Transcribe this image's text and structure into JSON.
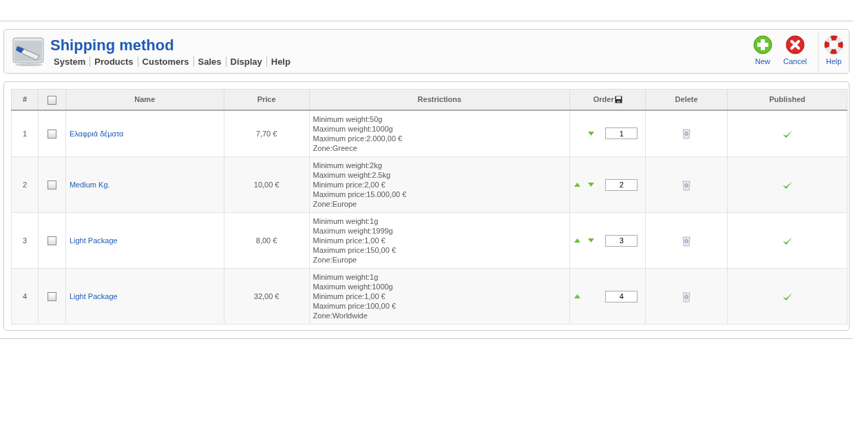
{
  "header": {
    "title": "Shipping method",
    "menu": [
      "System",
      "Products",
      "Customers",
      "Sales",
      "Display",
      "Help"
    ]
  },
  "toolbar": [
    {
      "kind": "new",
      "label": "New"
    },
    {
      "kind": "cancel",
      "label": "Cancel"
    },
    {
      "kind": "help",
      "label": "Help"
    }
  ],
  "table": {
    "columns": [
      "#",
      "Name",
      "Price",
      "Restrictions",
      "Order",
      "Delete",
      "Published"
    ],
    "select_all_checked": false,
    "rows": [
      {
        "number": "1",
        "checked": false,
        "name": "Ελαφριά δέματα",
        "price": "7,70 €",
        "restrictions": [
          "Minimum weight:50g",
          "Maximum weight:1000g",
          "Maximum price:2.000,00 €",
          "Zone:Greece"
        ],
        "move_up": false,
        "move_down": true,
        "order": "1",
        "published": true
      },
      {
        "number": "2",
        "checked": false,
        "name": "Medium Kg.",
        "price": "10,00 €",
        "restrictions": [
          "Minimum weight:2kg",
          "Maximum weight:2.5kg",
          "Minimum price:2,00 €",
          "Maximum price:15.000,00 €",
          "Zone:Europe"
        ],
        "move_up": true,
        "move_down": true,
        "order": "2",
        "published": true
      },
      {
        "number": "3",
        "checked": false,
        "name": "Light Package",
        "price": "8,00 €",
        "restrictions": [
          "Minimum weight:1g",
          "Maximum weight:1999g",
          "Minimum price:1,00 €",
          "Maximum price:150,00 €",
          "Zone:Europe"
        ],
        "move_up": true,
        "move_down": true,
        "order": "3",
        "published": true
      },
      {
        "number": "4",
        "checked": false,
        "name": "Light Package",
        "price": "32,00 €",
        "restrictions": [
          "Minimum weight:1g",
          "Maximum weight:1000g",
          "Minimum price:1,00 €",
          "Maximum price:100,00 €",
          "Zone:Worldwide"
        ],
        "move_up": true,
        "move_down": false,
        "order": "4",
        "published": true
      }
    ]
  }
}
